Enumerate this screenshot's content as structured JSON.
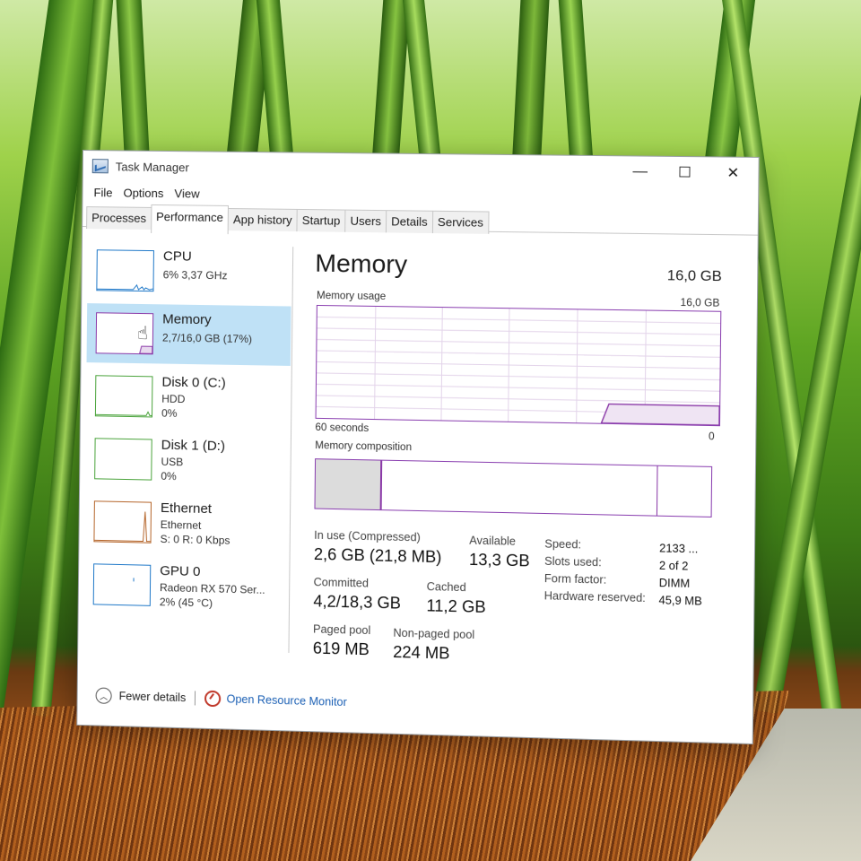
{
  "window": {
    "title": "Task Manager",
    "controls": {
      "minimize": "—",
      "maximize": "☐",
      "close": "✕"
    }
  },
  "menu": [
    "File",
    "Options",
    "View"
  ],
  "tabs": [
    {
      "label": "Processes",
      "active": false
    },
    {
      "label": "Performance",
      "active": true
    },
    {
      "label": "App history",
      "active": false
    },
    {
      "label": "Startup",
      "active": false
    },
    {
      "label": "Users",
      "active": false
    },
    {
      "label": "Details",
      "active": false
    },
    {
      "label": "Services",
      "active": false
    }
  ],
  "sidebar": [
    {
      "title": "CPU",
      "line1": "6% 3,37 GHz",
      "line2": "",
      "color": "#1f78c8",
      "selected": false
    },
    {
      "title": "Memory",
      "line1": "2,7/16,0 GB (17%)",
      "line2": "",
      "color": "#8b3aa8",
      "selected": true
    },
    {
      "title": "Disk 0 (C:)",
      "line1": "HDD",
      "line2": "0%",
      "color": "#4aa33b",
      "selected": false
    },
    {
      "title": "Disk 1 (D:)",
      "line1": "USB",
      "line2": "0%",
      "color": "#4aa33b",
      "selected": false
    },
    {
      "title": "Ethernet",
      "line1": "Ethernet",
      "line2": "S: 0 R: 0 Kbps",
      "color": "#b5652a",
      "selected": false
    },
    {
      "title": "GPU 0",
      "line1": "Radeon RX 570 Ser...",
      "line2": "2% (45 °C)",
      "color": "#1f78c8",
      "selected": false
    }
  ],
  "main": {
    "heading": "Memory",
    "total": "16,0 GB",
    "usage_label": "Memory usage",
    "usage_max": "16,0 GB",
    "time_left": "60 seconds",
    "time_right": "0",
    "composition_label": "Memory composition",
    "usage_level": 0.17,
    "stats": {
      "in_use_label": "In use (Compressed)",
      "in_use": "2,6 GB (21,8 MB)",
      "available_label": "Available",
      "available": "13,3 GB",
      "committed_label": "Committed",
      "committed": "4,2/18,3 GB",
      "cached_label": "Cached",
      "cached": "11,2 GB",
      "paged_label": "Paged pool",
      "paged": "619 MB",
      "nonpaged_label": "Non-paged pool",
      "nonpaged": "224 MB"
    },
    "specs": {
      "speed_label": "Speed:",
      "speed": "2133 ...",
      "slots_label": "Slots used:",
      "slots": "2 of 2",
      "form_label": "Form factor:",
      "form": "DIMM",
      "reserved_label": "Hardware reserved:",
      "reserved": "45,9 MB"
    }
  },
  "footer": {
    "fewer": "Fewer details",
    "monitor": "Open Resource Monitor"
  },
  "colors": {
    "memory": "#8b3aa8",
    "selection": "#bfe1f6",
    "link": "#1a5fb4"
  }
}
